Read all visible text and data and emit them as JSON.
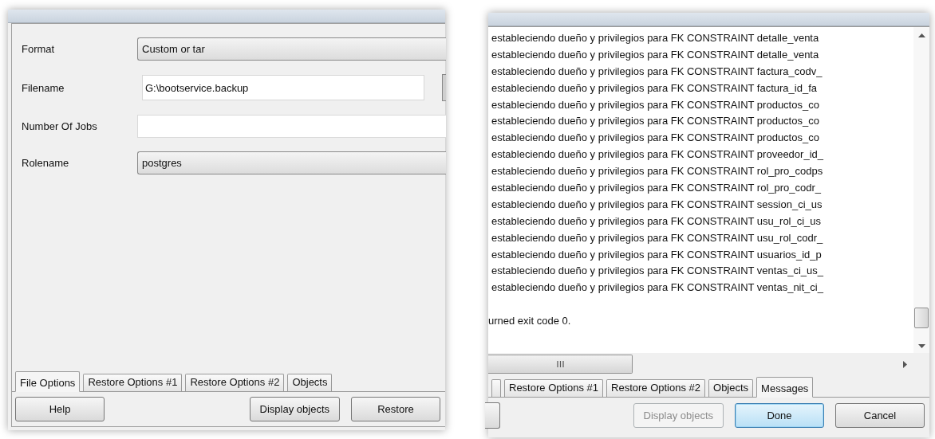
{
  "restore_dialog": {
    "fields": [
      {
        "label": "Format",
        "kind": "combo",
        "value": "Custom or tar"
      },
      {
        "label": "Filename",
        "kind": "file",
        "value": "G:\\bootservice.backup"
      },
      {
        "label": "Number Of Jobs",
        "kind": "text"
      },
      {
        "label": "Rolename",
        "kind": "combo",
        "value": "postgres"
      }
    ],
    "tabs": [
      {
        "label": "File Options",
        "selected": true
      },
      {
        "label": "Restore Options #1",
        "selected": false
      },
      {
        "label": "Restore Options #2",
        "selected": false
      },
      {
        "label": "Objects",
        "selected": false
      }
    ],
    "buttons": [
      {
        "label": "Help",
        "disabled": false,
        "default": false
      },
      {
        "label": "Display objects",
        "disabled": false,
        "default": false
      },
      {
        "label": "Restore",
        "disabled": false,
        "default": false
      }
    ]
  },
  "messages_dialog": {
    "log_lines": [
      "estableciendo dueño y privilegios para FK CONSTRAINT detalle_venta",
      "estableciendo dueño y privilegios para FK CONSTRAINT detalle_venta",
      "estableciendo dueño y privilegios para FK CONSTRAINT factura_codv_",
      "estableciendo dueño y privilegios para FK CONSTRAINT factura_id_fa",
      "estableciendo dueño y privilegios para FK CONSTRAINT productos_co",
      "estableciendo dueño y privilegios para FK CONSTRAINT productos_co",
      "estableciendo dueño y privilegios para FK CONSTRAINT productos_co",
      "estableciendo dueño y privilegios para FK CONSTRAINT proveedor_id_",
      "estableciendo dueño y privilegios para FK CONSTRAINT rol_pro_codps",
      "estableciendo dueño y privilegios para FK CONSTRAINT rol_pro_codr_",
      "estableciendo dueño y privilegios para FK CONSTRAINT session_ci_us",
      "estableciendo dueño y privilegios para FK CONSTRAINT usu_rol_ci_us",
      "estableciendo dueño y privilegios para FK CONSTRAINT usu_rol_codr_",
      "estableciendo dueño y privilegios para FK CONSTRAINT usuarios_id_p",
      "estableciendo dueño y privilegios para FK CONSTRAINT ventas_ci_us_",
      "estableciendo dueño y privilegios para FK CONSTRAINT ventas_nit_ci_"
    ],
    "exit_line": "urned exit code 0.",
    "tabs": [
      {
        "label": "Restore Options #1",
        "selected": false
      },
      {
        "label": "Restore Options #2",
        "selected": false
      },
      {
        "label": "Objects",
        "selected": false
      },
      {
        "label": "Messages",
        "selected": true
      }
    ],
    "buttons": [
      {
        "label": "Display objects",
        "disabled": true,
        "default": false
      },
      {
        "label": "Done",
        "disabled": false,
        "default": true
      },
      {
        "label": "Cancel",
        "disabled": false,
        "default": false
      }
    ]
  }
}
